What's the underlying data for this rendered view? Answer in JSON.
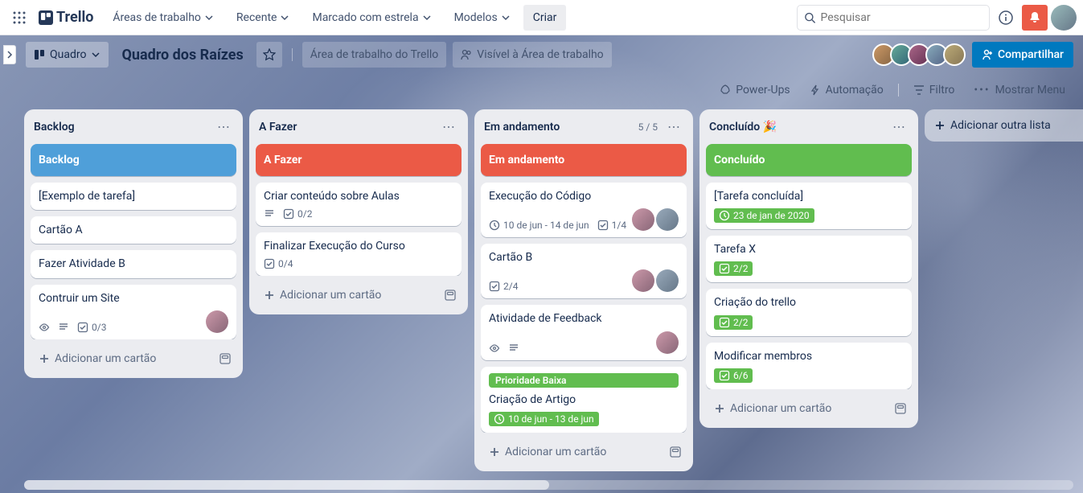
{
  "nav": {
    "logo": "Trello",
    "workspaces": "Áreas de trabalho",
    "recent": "Recente",
    "starred": "Marcado com estrela",
    "templates": "Modelos",
    "create": "Criar",
    "search_placeholder": "Pesquisar"
  },
  "board": {
    "view_btn": "Quadro",
    "title": "Quadro dos Raízes",
    "workspace_info": "Área de trabalho do Trello",
    "visibility": "Visível à Área de trabalho",
    "share": "Compartilhar",
    "power_ups": "Power-Ups",
    "automation": "Automação",
    "filter": "Filtro",
    "show_menu": "Mostrar Menu",
    "add_list": "Adicionar outra lista",
    "add_card": "Adicionar um cartão"
  },
  "lists": [
    {
      "title": "Backlog",
      "header_card": "Backlog",
      "header_color": "blue",
      "cards": [
        {
          "title": "[Exemplo de tarefa]"
        },
        {
          "title": "Cartão A"
        },
        {
          "title": "Fazer Atividade B"
        },
        {
          "title": "Contruir um Site",
          "watch": true,
          "desc": true,
          "checklist": "0/3",
          "members": 1
        }
      ]
    },
    {
      "title": "A Fazer",
      "header_card": "A Fazer",
      "header_color": "red",
      "cards": [
        {
          "title": "Criar conteúdo sobre Aulas",
          "desc": true,
          "checklist": "0/2"
        },
        {
          "title": "Finalizar Execução do Curso",
          "checklist": "0/4"
        }
      ]
    },
    {
      "title": "Em andamento",
      "count": "5 / 5",
      "header_card": "Em andamento",
      "header_color": "red",
      "cards": [
        {
          "title": "Execução do Código",
          "date": "10 de jun - 14 de jun",
          "checklist": "1/4",
          "members": 2
        },
        {
          "title": "Cartão B",
          "checklist": "2/4",
          "members": 2
        },
        {
          "title": "Atividade de Feedback",
          "watch": true,
          "desc": true,
          "members": 1
        },
        {
          "title": "Criação de Artigo",
          "label": "Prioridade Baixa",
          "date": "10 de jun - 13 de jun",
          "date_green": true
        }
      ]
    },
    {
      "title": "Concluído 🎉",
      "header_card": "Concluído",
      "header_color": "green",
      "cards": [
        {
          "title": "[Tarefa concluída]",
          "date": "23 de jan de 2020",
          "date_green": true
        },
        {
          "title": "Tarefa X",
          "checklist": "2/2",
          "check_green": true
        },
        {
          "title": "Criação do trello",
          "checklist": "2/2",
          "check_green": true
        },
        {
          "title": "Modificar membros",
          "checklist": "6/6",
          "check_green": true
        }
      ]
    }
  ]
}
